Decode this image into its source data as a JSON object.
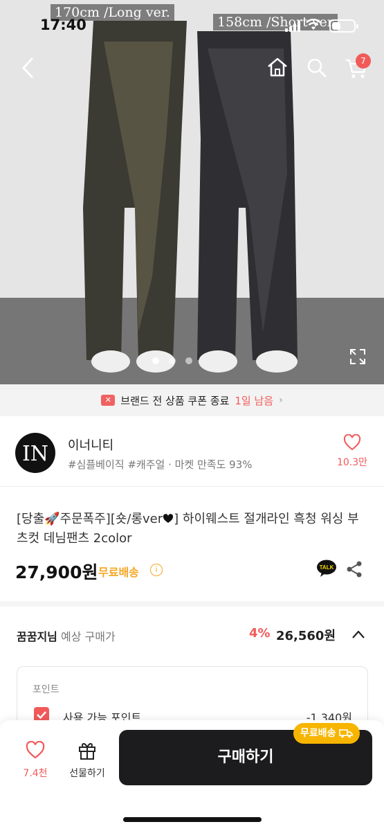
{
  "status": {
    "time": "17:40"
  },
  "hero": {
    "caption_long": "170cm /Long ver.",
    "caption_short": "158cm /Short ver",
    "cart_count": "7",
    "slide_count": 3,
    "active_slide": 0
  },
  "banner": {
    "text": "브랜드 전 상품 쿠폰 종료",
    "accent": "1일 남음"
  },
  "brand": {
    "logo_text": "IN",
    "name": "이너니티",
    "tags": "#심플베이직 #캐주얼 · 마켓 만족도 93%",
    "favorite_count": "10.3만"
  },
  "product": {
    "title_part1": "[당출🚀주문폭주][숏/롱ver",
    "title_part2": "] 하이웨스트 절개라인 흑청 워싱 부츠컷 데님팬츠 2color",
    "price": "27,900원",
    "shipping": "무료배송"
  },
  "member": {
    "name": "꿈꿈지님",
    "label": "예상 구매가",
    "discount": "4%",
    "price": "26,560원"
  },
  "points": {
    "title": "포인트",
    "label": "사용 가능 포인트",
    "value": "-1,340원"
  },
  "bottom": {
    "like_count": "7.4천",
    "gift_label": "선물하기",
    "buy_label": "구매하기",
    "ship_tag": "무료배송"
  },
  "colors": {
    "accent": "#f25a5a",
    "ship": "#f5a623",
    "buy_button": "#1c1c1e"
  }
}
